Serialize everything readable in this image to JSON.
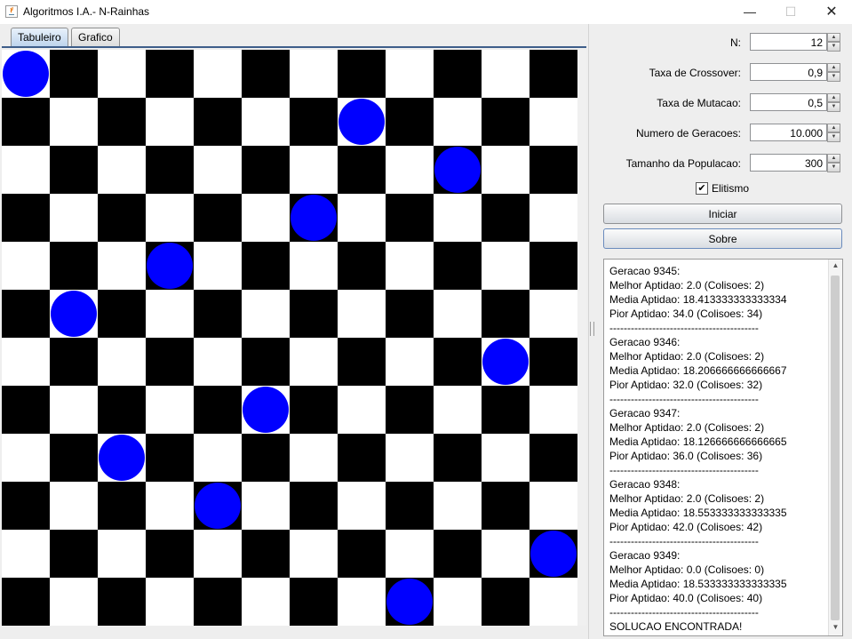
{
  "window": {
    "title": "Algoritmos I.A.- N-Rainhas",
    "min_icon": "minimize-icon",
    "max_icon": "maximize-icon",
    "close_icon": "close-icon"
  },
  "tabs": [
    {
      "label": "Tabuleiro",
      "active": true
    },
    {
      "label": "Grafico",
      "active": false
    }
  ],
  "board": {
    "n": 12,
    "colors": {
      "dark": "#000000",
      "light": "#ffffff",
      "queen": "#0000ff"
    },
    "queen_columns_by_row": [
      0,
      7,
      9,
      6,
      3,
      1,
      10,
      5,
      2,
      4,
      11,
      8
    ]
  },
  "params": {
    "n_label": "N:",
    "n_value": "12",
    "crossover_label": "Taxa de Crossover:",
    "crossover_value": "0,9",
    "mutation_label": "Taxa de Mutacao:",
    "mutation_value": "0,5",
    "generations_label": "Numero de Geracoes:",
    "generations_value": "10.000",
    "population_label": "Tamanho da Populacao:",
    "population_value": "300",
    "elitism_label": "Elitismo",
    "elitism_checked": true
  },
  "buttons": {
    "start": "Iniciar",
    "about": "Sobre"
  },
  "log": {
    "text": "Geracao 9345:\nMelhor Aptidao: 2.0 (Colisoes: 2)\nMedia Aptidao: 18.413333333333334\nPior Aptidao: 34.0 (Colisoes: 34)\n------------------------------------------\nGeracao 9346:\nMelhor Aptidao: 2.0 (Colisoes: 2)\nMedia Aptidao: 18.206666666666667\nPior Aptidao: 32.0 (Colisoes: 32)\n------------------------------------------\nGeracao 9347:\nMelhor Aptidao: 2.0 (Colisoes: 2)\nMedia Aptidao: 18.126666666666665\nPior Aptidao: 36.0 (Colisoes: 36)\n------------------------------------------\nGeracao 9348:\nMelhor Aptidao: 2.0 (Colisoes: 2)\nMedia Aptidao: 18.553333333333335\nPior Aptidao: 42.0 (Colisoes: 42)\n------------------------------------------\nGeracao 9349:\nMelhor Aptidao: 0.0 (Colisoes: 0)\nMedia Aptidao: 18.533333333333335\nPior Aptidao: 40.0 (Colisoes: 40)\n------------------------------------------\nSOLUCAO ENCONTRADA!"
  }
}
